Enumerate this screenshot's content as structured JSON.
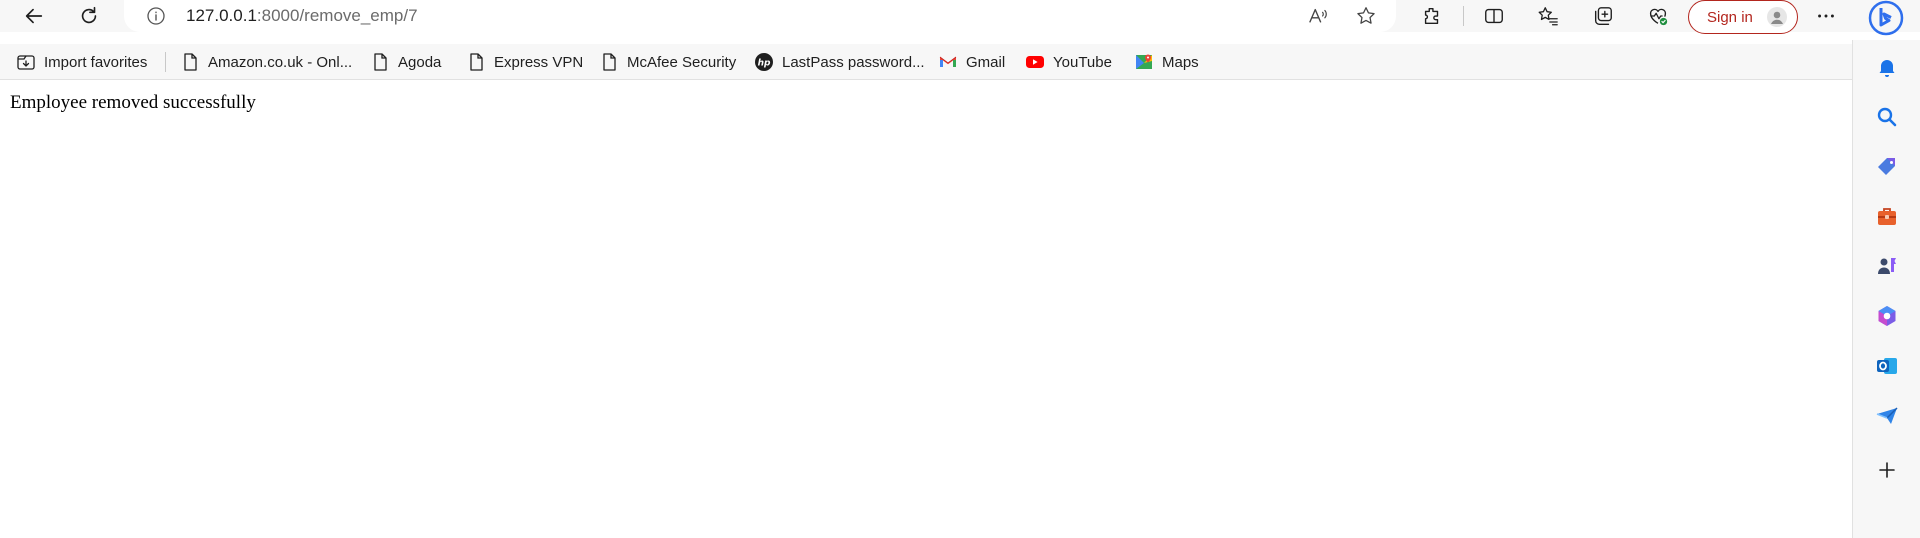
{
  "browser": {
    "address": {
      "host": "127.0.0.1",
      "path": ":8000/remove_emp/7"
    },
    "toolbar_icons": [
      "back-icon",
      "refresh-icon",
      "site-info-icon",
      "read-aloud-icon",
      "favorite-star-icon",
      "extensions-icon",
      "split-screen-icon",
      "favorites-icon",
      "collections-icon",
      "browser-essentials-icon",
      "more-options-icon",
      "bing-copilot-icon"
    ],
    "sign_in": {
      "label": "Sign in"
    },
    "accent_color": "#b3261e"
  },
  "favorites": [
    {
      "label": "Import favorites",
      "icon": "import-favorites-icon"
    },
    {
      "label": "Amazon.co.uk - Onl...",
      "icon": "page-icon"
    },
    {
      "label": "Agoda",
      "icon": "page-icon"
    },
    {
      "label": "Express VPN",
      "icon": "page-icon"
    },
    {
      "label": "McAfee Security",
      "icon": "page-icon"
    },
    {
      "label": "LastPass password...",
      "icon": "hp-icon"
    },
    {
      "label": "Gmail",
      "icon": "gmail-icon"
    },
    {
      "label": "YouTube",
      "icon": "youtube-icon"
    },
    {
      "label": "Maps",
      "icon": "maps-icon"
    }
  ],
  "page": {
    "message": "Employee removed successfully"
  },
  "sidebar": {
    "icons": [
      "notifications-icon",
      "search-icon",
      "shopping-tag-icon",
      "tools-briefcase-icon",
      "games-icon",
      "microsoft365-icon",
      "outlook-icon",
      "send-icon",
      "add-icon"
    ]
  }
}
